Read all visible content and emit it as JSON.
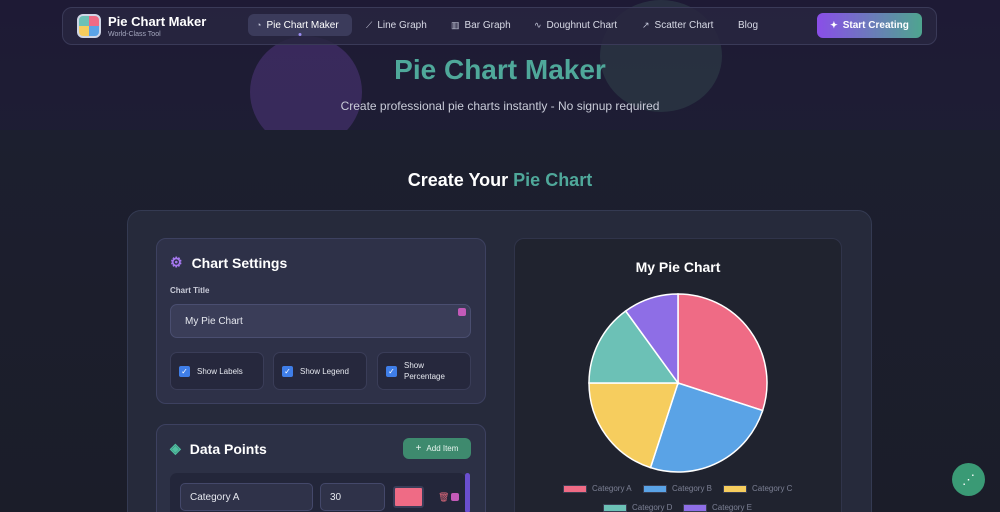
{
  "nav": {
    "brand_title": "Pie Chart Maker",
    "brand_subtitle": "World-Class Tool",
    "items": [
      {
        "label": "Pie Chart Maker",
        "icon": "pie-icon"
      },
      {
        "label": "Line Graph",
        "icon": "line-chart-icon"
      },
      {
        "label": "Bar Graph",
        "icon": "bar-chart-icon"
      },
      {
        "label": "Doughnut Chart",
        "icon": "activity-icon"
      },
      {
        "label": "Scatter Chart",
        "icon": "trend-icon"
      },
      {
        "label": "Blog",
        "icon": ""
      }
    ],
    "cta_label": "Start Creating"
  },
  "hero": {
    "title": "Pie Chart Maker",
    "subtitle": "Create professional pie charts instantly - No signup required"
  },
  "section": {
    "title_prefix": "Create Your",
    "title_accent": "Pie Chart"
  },
  "settings": {
    "heading": "Chart Settings",
    "title_label": "Chart Title",
    "title_value": "My Pie Chart",
    "options": [
      {
        "label": "Show Labels",
        "checked": true
      },
      {
        "label": "Show Legend",
        "checked": true
      },
      {
        "label": "Show Percentage",
        "checked": true
      }
    ]
  },
  "data_points": {
    "heading": "Data Points",
    "add_label": "Add Item",
    "rows": [
      {
        "category": "Category A",
        "value": "30",
        "color": "#ef6b85"
      }
    ]
  },
  "colors": {
    "accent": "#4fa89a",
    "cta_start": "#8a4ee8",
    "cta_end": "#4ea58f"
  },
  "chart_data": {
    "type": "pie",
    "title": "My Pie Chart",
    "categories": [
      "Category A",
      "Category B",
      "Category C",
      "Category D",
      "Category E"
    ],
    "values": [
      30,
      25,
      20,
      15,
      10
    ],
    "colors": [
      "#ef6b85",
      "#5aa3e6",
      "#f6cd5e",
      "#6cc1b6",
      "#8e6ee6"
    ],
    "legend_position": "bottom"
  }
}
